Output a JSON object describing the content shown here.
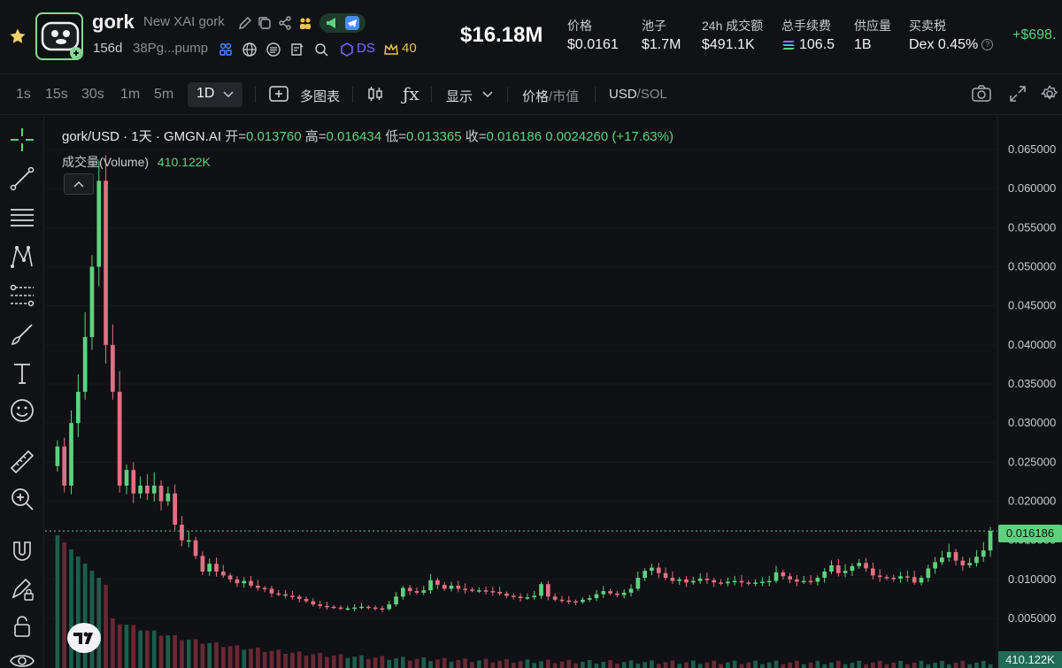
{
  "token": {
    "symbol": "gork",
    "full_name": "New XAI gork",
    "age": "156d",
    "address_short": "38Pg...pump",
    "ds_label": "DS",
    "holders_badge": "40"
  },
  "header_stats": {
    "market_cap": "$16.18M",
    "price_label": "价格",
    "price_value": "$0.0161",
    "pool_label": "池子",
    "pool_value": "$1.7M",
    "volume_label": "24h 成交额",
    "volume_value": "$491.1K",
    "fees_label": "总手续费",
    "fees_value": "106.5",
    "supply_label": "供应量",
    "supply_value": "1B",
    "tax_label": "买卖税",
    "tax_value": "Dex 0.45%",
    "change_value": "+$698."
  },
  "toolbar": {
    "timeframes": [
      "1s",
      "15s",
      "30s",
      "1m",
      "5m"
    ],
    "active_timeframe": "1D",
    "multi_chart": "多图表",
    "fx": "ƒx",
    "display": "显示",
    "price_toggle": "价格",
    "mcap_toggle": "市值",
    "currency_usd": "USD",
    "currency_sol": "SOL",
    "slash": "/"
  },
  "legend": {
    "title": "gork/USD · 1天 · GMGN.AI",
    "open_label": "开=",
    "open_value": "0.013760",
    "high_label": "高=",
    "high_value": "0.016434",
    "low_label": "低=",
    "low_value": "0.013365",
    "close_label": "收=",
    "close_value": "0.016186",
    "change": "0.0024260 (+17.63%)",
    "volume_label": "成交量(Volume)",
    "volume_value": "410.122K"
  },
  "current_price_tag": "0.016186",
  "current_volume_tag": "410.122K",
  "colors": {
    "up": "#5fd17e",
    "down": "#e46f84",
    "vol_up": "#1f6b55",
    "vol_down": "#7a2d3b",
    "accent_yellow": "#f0c14b",
    "accent_blue": "#4a8cff"
  },
  "chart_data": {
    "type": "candlestick",
    "title": "gork/USD · 1天 · GMGN.AI",
    "y_ticks": [
      "0.065000",
      "0.060000",
      "0.055000",
      "0.050000",
      "0.045000",
      "0.040000",
      "0.035000",
      "0.030000",
      "0.025000",
      "0.020000",
      "0.015000",
      "0.010000",
      "0.005000"
    ],
    "ylim": [
      0.0,
      0.068
    ],
    "close_series": [
      0.027,
      0.022,
      0.03,
      0.034,
      0.041,
      0.05,
      0.061,
      0.04,
      0.034,
      0.022,
      0.024,
      0.021,
      0.022,
      0.021,
      0.022,
      0.02,
      0.021,
      0.017,
      0.015,
      0.015,
      0.013,
      0.011,
      0.012,
      0.011,
      0.0105,
      0.01,
      0.0095,
      0.0098,
      0.0092,
      0.0089,
      0.0088,
      0.0082,
      0.0081,
      0.0079,
      0.0078,
      0.0075,
      0.0072,
      0.0068,
      0.0066,
      0.0065,
      0.0064,
      0.0063,
      0.0063,
      0.0064,
      0.0065,
      0.0064,
      0.0063,
      0.0062,
      0.0068,
      0.0078,
      0.0089,
      0.0085,
      0.0083,
      0.0086,
      0.0099,
      0.0093,
      0.0088,
      0.0092,
      0.0088,
      0.0087,
      0.0086,
      0.0086,
      0.0085,
      0.0084,
      0.0082,
      0.0079,
      0.0078,
      0.0076,
      0.0077,
      0.0079,
      0.0094,
      0.0078,
      0.0074,
      0.0073,
      0.0072,
      0.0071,
      0.0074,
      0.0076,
      0.0081,
      0.0085,
      0.0082,
      0.008,
      0.0083,
      0.0088,
      0.0102,
      0.0111,
      0.0115,
      0.0108,
      0.0102,
      0.0098,
      0.01,
      0.0096,
      0.0098,
      0.0101,
      0.0099,
      0.0096,
      0.0095,
      0.0097,
      0.0098,
      0.0096,
      0.0095,
      0.0096,
      0.0097,
      0.0098,
      0.0109,
      0.0104,
      0.01,
      0.0097,
      0.0098,
      0.0097,
      0.0102,
      0.011,
      0.0118,
      0.0108,
      0.0111,
      0.0117,
      0.0121,
      0.0114,
      0.0105,
      0.0103,
      0.0102,
      0.0101,
      0.0104,
      0.0103,
      0.0096,
      0.0102,
      0.0114,
      0.0122,
      0.0128,
      0.0135,
      0.0124,
      0.0118,
      0.0121,
      0.0129,
      0.0137,
      0.0162
    ]
  }
}
